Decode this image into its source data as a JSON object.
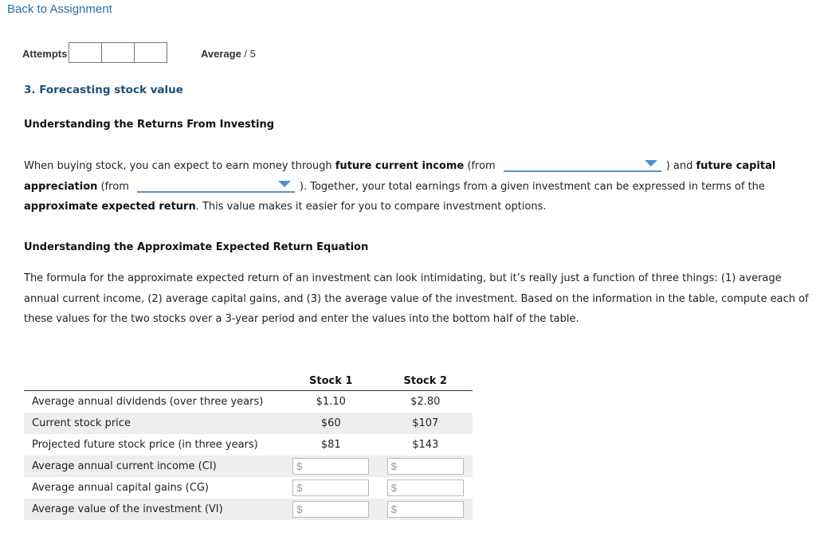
{
  "nav": {
    "back_label": "Back to Assignment"
  },
  "header": {
    "attempts_label": "Attempts",
    "attempt_boxes": [
      "",
      "",
      ""
    ],
    "average_label": "Average",
    "average_suffix": "/ 5"
  },
  "question": {
    "title": "3. Forecasting stock value"
  },
  "section1": {
    "heading": "Understanding the Returns From Investing",
    "p1_a": "When buying stock, you can expect to earn money through ",
    "p1_b_bold": "future current income",
    "p1_c": " (from",
    "dropdown1_value": "",
    "p1_d": ") and ",
    "p1_e_bold": "future capital appreciation",
    "p1_f": " (from",
    "dropdown2_value": "",
    "p1_g": "). Together, your total earnings from a given investment can be expressed in terms of the ",
    "p1_h_bold": "approximate expected return",
    "p1_i": ". This value makes it easier for you to compare investment options."
  },
  "section2": {
    "heading": "Understanding the Approximate Expected Return Equation",
    "paragraph": "The formula for the approximate expected return of an investment can look intimidating, but it’s really just a function of three things: (1) average annual current income, (2) average capital gains, and (3) the average value of the investment. Based on the information in the table, compute each of these values for the two stocks over a 3-year period and enter the values into the bottom half of the table."
  },
  "table": {
    "columns": [
      "",
      "Stock 1",
      "Stock 2"
    ],
    "given_rows": [
      {
        "label": "Average annual dividends (over three years)",
        "stock1": "$1.10",
        "stock2": "$2.80"
      },
      {
        "label": "Current stock price",
        "stock1": "$60",
        "stock2": "$107"
      },
      {
        "label": "Projected future stock price (in three years)",
        "stock1": "$81",
        "stock2": "$143"
      }
    ],
    "input_rows": [
      {
        "label": "Average annual current income (CI)",
        "stock1_value": "",
        "stock2_value": ""
      },
      {
        "label": "Average annual capital gains (CG)",
        "stock1_value": "",
        "stock2_value": ""
      },
      {
        "label": "Average value of the investment (VI)",
        "stock1_value": "",
        "stock2_value": ""
      }
    ],
    "input_placeholder": "$"
  }
}
